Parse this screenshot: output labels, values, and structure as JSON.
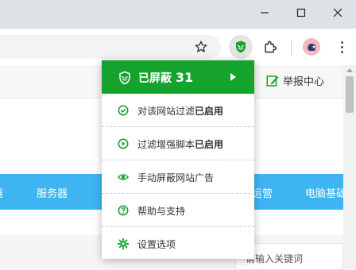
{
  "browser": {
    "window_controls": [
      "minimize",
      "maximize",
      "close"
    ],
    "toolbar_icons": [
      "star-icon",
      "shield-extension-icon",
      "puzzle-icon",
      "avatar",
      "more-icon"
    ]
  },
  "page": {
    "report_link": "举报中心",
    "nav_items": [
      "服务器",
      "运营",
      "电脑基础"
    ],
    "nav_partial_left": "器",
    "search_placeholder": "请输入关键词"
  },
  "popup": {
    "title": "已屏蔽",
    "blocked_count": "31",
    "items": [
      {
        "icon": "check-circle-icon",
        "label": "对该网站过滤",
        "status": "已启用"
      },
      {
        "icon": "play-circle-icon",
        "label": "过滤增强脚本",
        "status": "已启用"
      },
      {
        "icon": "eye-icon",
        "label": "手动屏蔽网站广告",
        "status": ""
      },
      {
        "icon": "help-circle-icon",
        "label": "帮助与支持",
        "status": ""
      },
      {
        "icon": "gear-icon",
        "label": "设置选项",
        "status": ""
      }
    ]
  },
  "colors": {
    "accent_green": "#15a32e",
    "nav_blue": "#3fb4f2"
  }
}
